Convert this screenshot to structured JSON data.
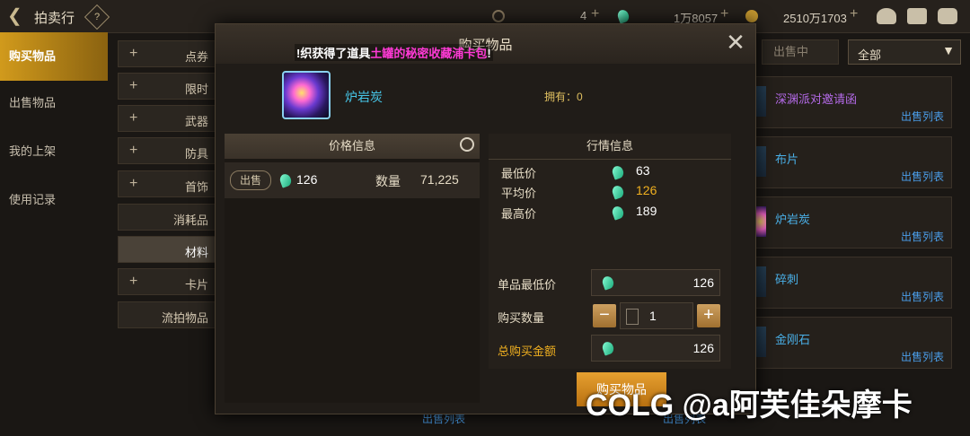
{
  "header": {
    "back_icon": "back-arrow-icon",
    "title": "拍卖行",
    "help": "?",
    "currency1_value": "4",
    "currency2_value": "1万8057",
    "currency3_value": "2510万1703",
    "plus": "+"
  },
  "sidebar": {
    "items": [
      {
        "label": "购买物品"
      },
      {
        "label": "出售物品"
      },
      {
        "label": "我的上架"
      },
      {
        "label": "使用记录"
      }
    ]
  },
  "categories": [
    {
      "label": "点券",
      "plus": "+"
    },
    {
      "label": "限时",
      "plus": "+"
    },
    {
      "label": "武器",
      "plus": "+"
    },
    {
      "label": "防具",
      "plus": "+"
    },
    {
      "label": "首饰",
      "plus": "+"
    },
    {
      "label": "消耗品",
      "plus": ""
    },
    {
      "label": "材料",
      "plus": ""
    },
    {
      "label": "卡片",
      "plus": "+"
    },
    {
      "label": "流拍物品",
      "plus": ""
    }
  ],
  "filter": {
    "status_label": "出售中",
    "dropdown_value": "全部"
  },
  "right_list": [
    {
      "name": "深渊派对邀请函",
      "name_color": "#b46ae8",
      "link": "出售列表"
    },
    {
      "name": "布片",
      "name_color": "#4ab0e8",
      "link": "出售列表"
    },
    {
      "name": "炉岩炭",
      "name_color": "#4ab0e8",
      "link": "出售列表"
    },
    {
      "name": "碎刺",
      "name_color": "#4ab0e8",
      "link": "出售列表"
    },
    {
      "name": "金刚石",
      "name_color": "#4ab0e8",
      "link": "出售列表"
    }
  ],
  "bottom_links": {
    "left": "出售列表",
    "right": "出售列表"
  },
  "modal": {
    "title": "购买物品",
    "notice_prefix": "!织获得了道具",
    "notice_item": "土罐的秘密收藏浦卡包",
    "notice_suffix": "!",
    "item_name": "炉岩炭",
    "owned_label": "拥有：0",
    "price_panel": {
      "header": "价格信息",
      "sell_tag": "出售",
      "price": "126",
      "qty_label": "数量",
      "qty_value": "71,225"
    },
    "market_panel": {
      "header": "行情信息",
      "rows": [
        {
          "label": "最低价",
          "value": "63",
          "color": "#ffffff"
        },
        {
          "label": "平均价",
          "value": "126",
          "color": "#f0b020"
        },
        {
          "label": "最高价",
          "value": "189",
          "color": "#ffffff"
        }
      ]
    },
    "purchase": {
      "unit_min_label": "单品最低价",
      "unit_min_value": "126",
      "qty_label": "购买数量",
      "qty_value": "1",
      "minus": "−",
      "plus": "+",
      "total_label": "总购买金额",
      "total_value": "126",
      "buy_button": "购买物品"
    }
  },
  "watermark": "COLG @a阿芙佳朵摩卡",
  "colors": {
    "accent": "#d19a1c",
    "link": "#4a9de8",
    "gem": "#18a878",
    "highlight": "#ff3ad6"
  }
}
